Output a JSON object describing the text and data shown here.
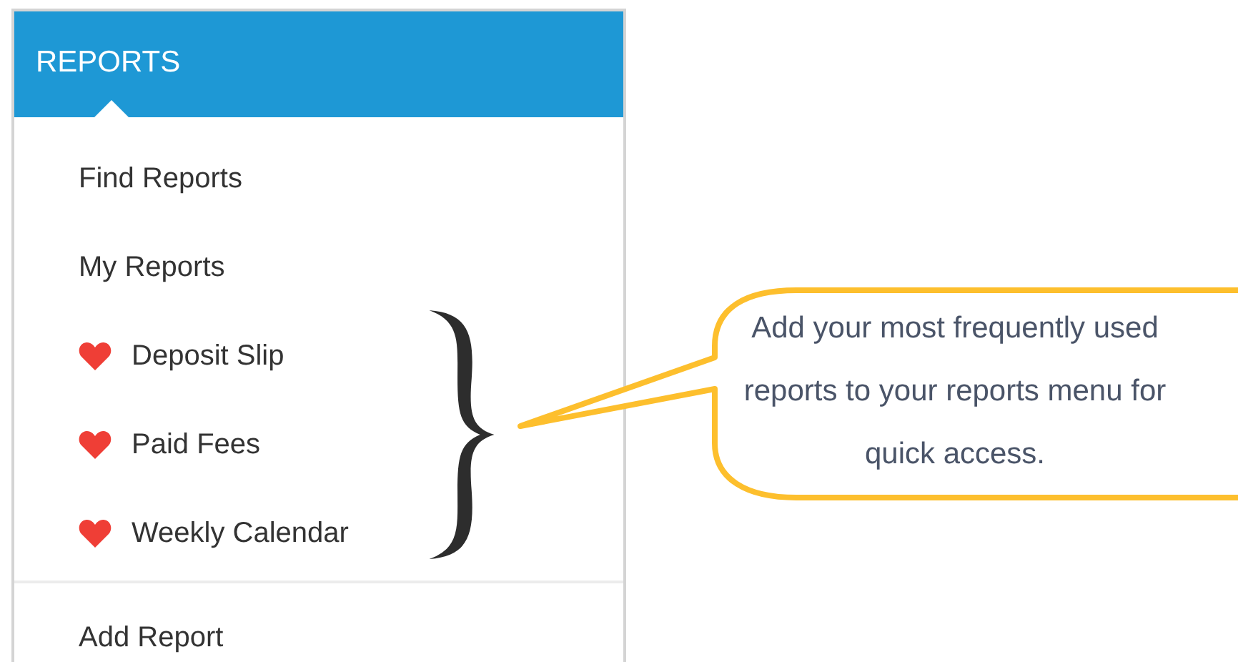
{
  "menu": {
    "title": "REPORTS",
    "items": [
      {
        "kind": "plain",
        "label": "Find Reports"
      },
      {
        "kind": "plain",
        "label": "My Reports"
      },
      {
        "kind": "favorite",
        "label": "Deposit Slip"
      },
      {
        "kind": "favorite",
        "label": "Paid Fees"
      },
      {
        "kind": "favorite",
        "label": "Weekly Calendar"
      }
    ],
    "footer_item": "Add Report"
  },
  "callout": {
    "text": "Add your most frequently used reports to your reports menu for quick access."
  }
}
